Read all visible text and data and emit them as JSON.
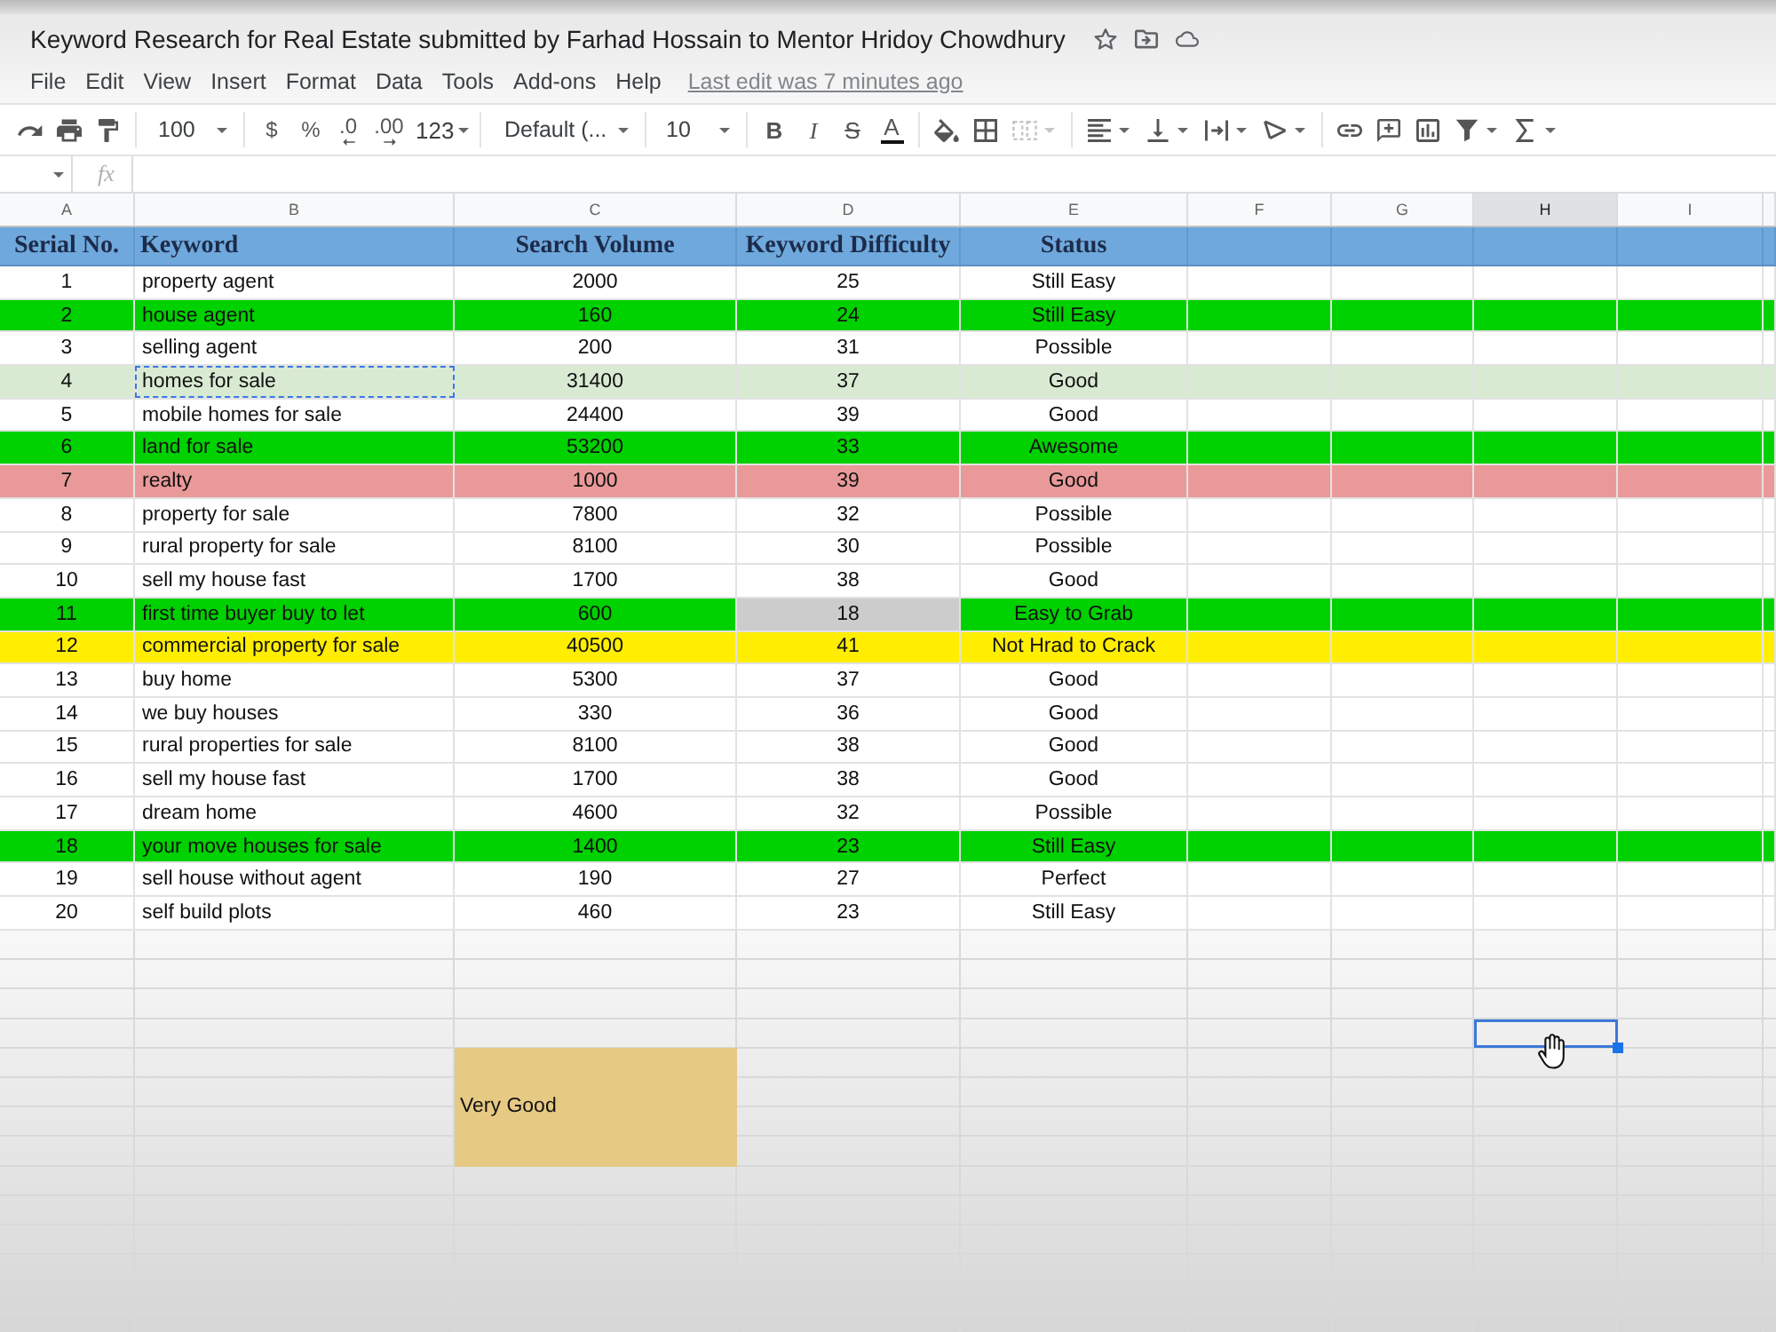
{
  "document": {
    "title": "Keyword Research for Real Estate submitted by Farhad Hossain to Mentor Hridoy Chowdhury"
  },
  "menu": [
    "File",
    "Edit",
    "View",
    "Insert",
    "Format",
    "Data",
    "Tools",
    "Add-ons",
    "Help"
  ],
  "last_edit": "Last edit was 7 minutes ago",
  "toolbar": {
    "zoom": "100",
    "number_buttons": [
      {
        "label": "$",
        "kind": "currency"
      },
      {
        "label": "%",
        "kind": "percent"
      },
      {
        "label": ".0",
        "kind": "decrease-decimals"
      },
      {
        "label": ".00",
        "kind": "increase-decimals"
      }
    ],
    "number_format": "123",
    "font": "Default (...",
    "font_size": "10",
    "style_buttons": [
      {
        "label": "B",
        "kind": "bold"
      },
      {
        "label": "I",
        "kind": "italic"
      },
      {
        "label": "S",
        "kind": "strikethrough"
      },
      {
        "label": "A",
        "kind": "text-color"
      }
    ],
    "merge_disabled": true
  },
  "formula_bar": {
    "label": "fx"
  },
  "sheet": {
    "columns": [
      {
        "label": "A",
        "selected": false
      },
      {
        "label": "B",
        "selected": false
      },
      {
        "label": "C",
        "selected": false
      },
      {
        "label": "D",
        "selected": false
      },
      {
        "label": "E",
        "selected": false
      },
      {
        "label": "F",
        "selected": false
      },
      {
        "label": "G",
        "selected": false
      },
      {
        "label": "H",
        "selected": true
      },
      {
        "label": "I",
        "selected": false
      }
    ],
    "header": [
      "Serial No.",
      "Keyword",
      "Search Volume",
      "Keyword Difficulty",
      "Status"
    ],
    "rows": [
      {
        "serial": "1",
        "keyword": "property agent",
        "search_volume": "2000",
        "keyword_difficulty": "25",
        "status": "Still Easy",
        "color": "#ffffff",
        "copied": false
      },
      {
        "serial": "2",
        "keyword": "house agent",
        "search_volume": "160",
        "keyword_difficulty": "24",
        "status": "Still Easy",
        "color": "#00d100",
        "copied": false
      },
      {
        "serial": "3",
        "keyword": "selling agent",
        "search_volume": "200",
        "keyword_difficulty": "31",
        "status": "Possible",
        "color": "#ffffff",
        "copied": false
      },
      {
        "serial": "4",
        "keyword": "homes for sale",
        "search_volume": "31400",
        "keyword_difficulty": "37",
        "status": "Good",
        "color": "#d9ead3",
        "copied": true
      },
      {
        "serial": "5",
        "keyword": "mobile homes for sale",
        "search_volume": "24400",
        "keyword_difficulty": "39",
        "status": "Good",
        "color": "#ffffff",
        "copied": false
      },
      {
        "serial": "6",
        "keyword": "land for sale",
        "search_volume": "53200",
        "keyword_difficulty": "33",
        "status": "Awesome",
        "color": "#00d100",
        "copied": false
      },
      {
        "serial": "7",
        "keyword": "realty",
        "search_volume": "1000",
        "keyword_difficulty": "39",
        "status": "Good",
        "color": "#ea9999",
        "copied": false
      },
      {
        "serial": "8",
        "keyword": "property for sale",
        "search_volume": "7800",
        "keyword_difficulty": "32",
        "status": "Possible",
        "color": "#ffffff",
        "copied": false
      },
      {
        "serial": "9",
        "keyword": "rural property for sale",
        "search_volume": "8100",
        "keyword_difficulty": "30",
        "status": "Possible",
        "color": "#ffffff",
        "copied": false
      },
      {
        "serial": "10",
        "keyword": "sell my house fast",
        "search_volume": "1700",
        "keyword_difficulty": "38",
        "status": "Good",
        "color": "#ffffff",
        "copied": false
      },
      {
        "serial": "11",
        "keyword": "first time buyer buy to let",
        "search_volume": "600",
        "keyword_difficulty": "18",
        "status": "Easy to Grab",
        "color": "#00d100",
        "difficulty_cell": {
          "color": "#cccccc"
        },
        "copied": false
      },
      {
        "serial": "12",
        "keyword": "commercial property for sale",
        "search_volume": "40500",
        "keyword_difficulty": "41",
        "status": "Not Hrad to Crack",
        "color": "#ffee00",
        "copied": false
      },
      {
        "serial": "13",
        "keyword": "buy home",
        "search_volume": "5300",
        "keyword_difficulty": "37",
        "status": "Good",
        "color": "#ffffff",
        "copied": false
      },
      {
        "serial": "14",
        "keyword": "we buy houses",
        "search_volume": "330",
        "keyword_difficulty": "36",
        "status": "Good",
        "color": "#ffffff",
        "copied": false
      },
      {
        "serial": "15",
        "keyword": "rural properties for sale",
        "search_volume": "8100",
        "keyword_difficulty": "38",
        "status": "Good",
        "color": "#ffffff",
        "copied": false
      },
      {
        "serial": "16",
        "keyword": "sell my house fast",
        "search_volume": "1700",
        "keyword_difficulty": "38",
        "status": "Good",
        "color": "#ffffff",
        "copied": false
      },
      {
        "serial": "17",
        "keyword": "dream home",
        "search_volume": "4600",
        "keyword_difficulty": "32",
        "status": "Possible",
        "color": "#ffffff",
        "copied": false
      },
      {
        "serial": "18",
        "keyword": "your move houses for sale",
        "search_volume": "1400",
        "keyword_difficulty": "23",
        "status": "Still Easy",
        "color": "#00d100",
        "copied": false
      },
      {
        "serial": "19",
        "keyword": "sell house without agent",
        "search_volume": "190",
        "keyword_difficulty": "27",
        "status": "Perfect",
        "color": "#ffffff",
        "copied": false
      },
      {
        "serial": "20",
        "keyword": "self build plots",
        "search_volume": "460",
        "keyword_difficulty": "23",
        "status": "Still Easy",
        "color": "#ffffff",
        "copied": false
      }
    ],
    "merged_cell": {
      "text": "Very Good"
    }
  }
}
